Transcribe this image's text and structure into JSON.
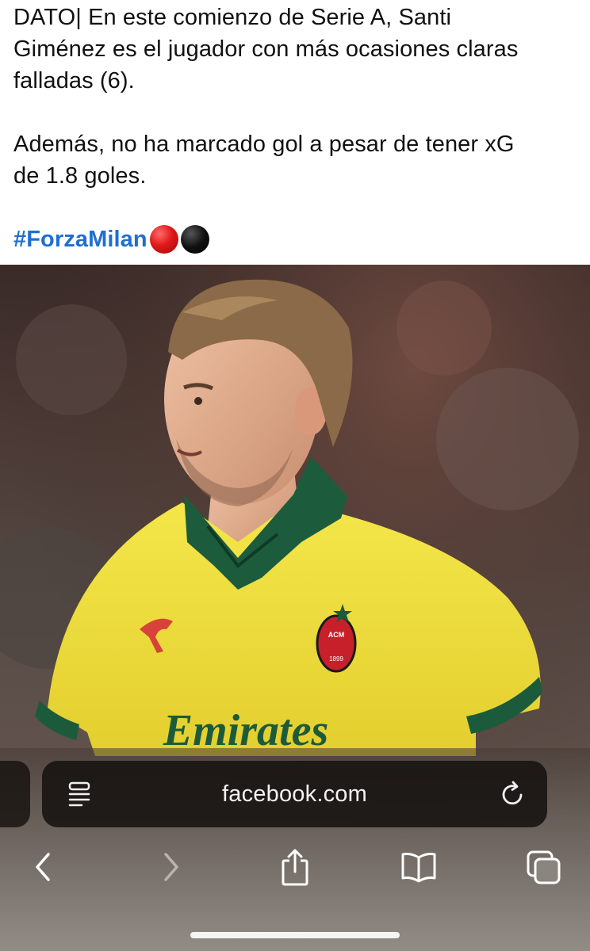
{
  "post": {
    "line1": "DATO| En este comienzo de Serie A, Santi",
    "line2": "Giménez es el jugador con más ocasiones claras",
    "line3": "falladas (6).",
    "line4": "Además, no ha marcado gol a pesar de tener xG",
    "line5": "de 1.8 goles.",
    "hashtag": "#ForzaMilan",
    "emoji_colors": [
      "#e01818",
      "#111111"
    ]
  },
  "photo": {
    "jersey_sponsor": "Emirates",
    "crest_text": "ACM",
    "crest_year": "1899"
  },
  "browser": {
    "url": "facebook.com",
    "icons": [
      "reader-icon",
      "reload-icon",
      "back-icon",
      "forward-icon",
      "share-icon",
      "bookmarks-icon",
      "tabs-icon"
    ]
  }
}
